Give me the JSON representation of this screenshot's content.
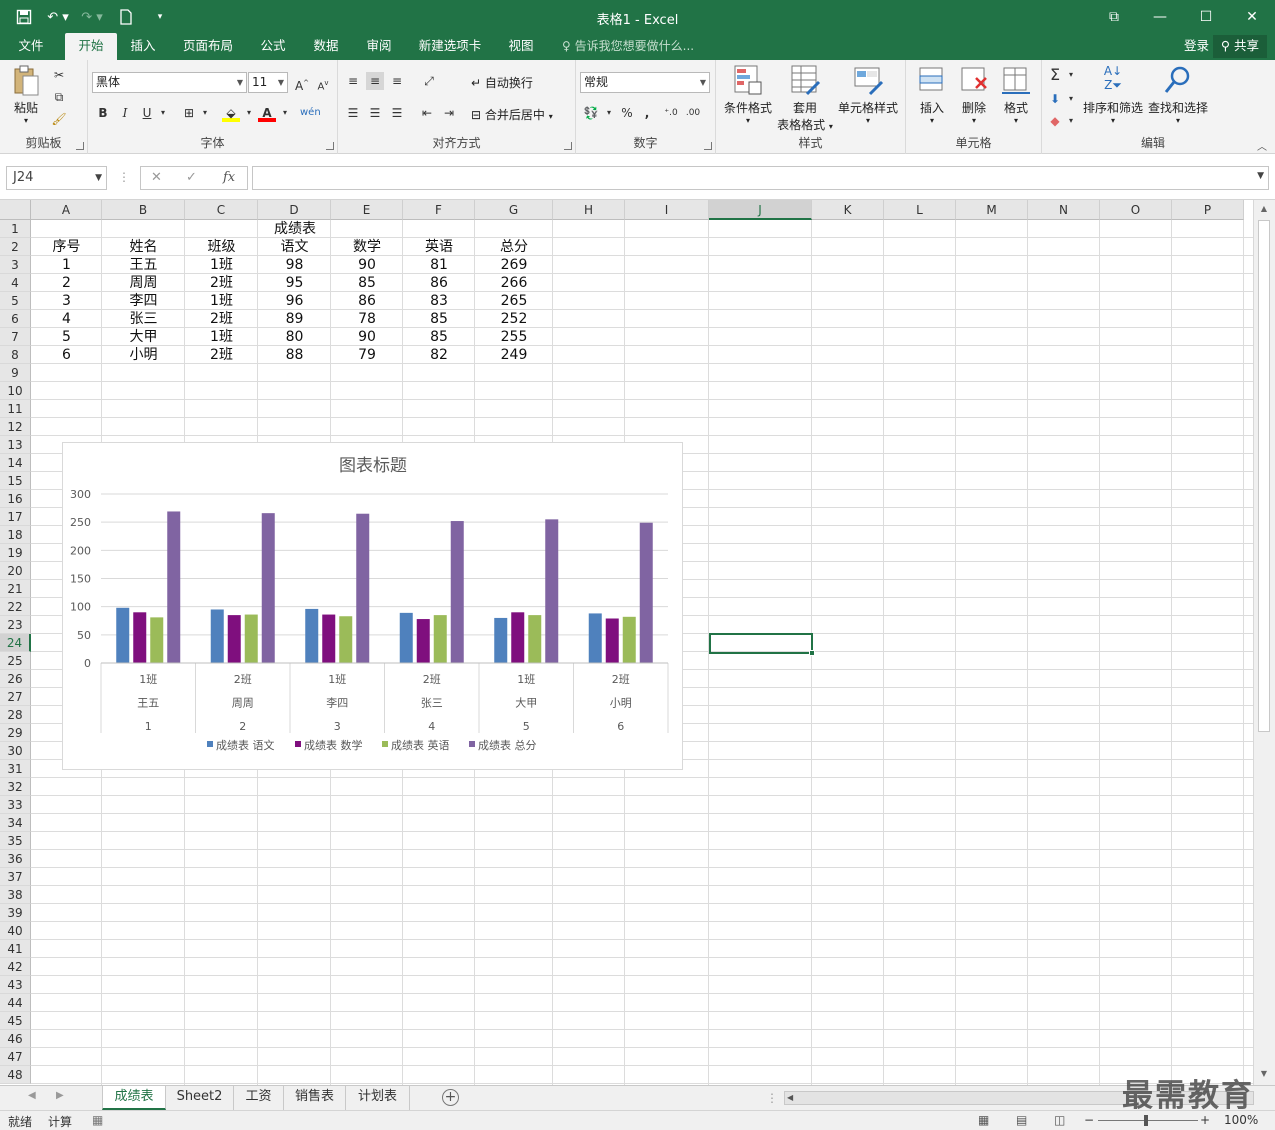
{
  "window": {
    "title": "表格1 - Excel",
    "qat": [
      "save-icon",
      "undo-icon",
      "redo-icon",
      "new-icon",
      "customize-icon"
    ],
    "controls": [
      "ribbon-display-icon",
      "minimize-icon",
      "maximize-icon",
      "close-icon"
    ]
  },
  "tabs": [
    {
      "label": "文件",
      "active": false
    },
    {
      "label": "开始",
      "active": true
    },
    {
      "label": "插入",
      "active": false
    },
    {
      "label": "页面布局",
      "active": false
    },
    {
      "label": "公式",
      "active": false
    },
    {
      "label": "数据",
      "active": false
    },
    {
      "label": "审阅",
      "active": false
    },
    {
      "label": "新建选项卡",
      "active": false
    },
    {
      "label": "视图",
      "active": false
    }
  ],
  "tell_me": "告诉我您想要做什么...",
  "login": "登录",
  "share": "共享",
  "ribbon": {
    "clipboard": {
      "label": "剪贴板",
      "paste": "粘贴"
    },
    "font": {
      "label": "字体",
      "family": "黑体",
      "size": "11",
      "bold": "B",
      "italic": "I",
      "underline": "U"
    },
    "alignment": {
      "label": "对齐方式",
      "wrap": "自动换行",
      "merge": "合并后居中"
    },
    "number": {
      "label": "数字",
      "format": "常规",
      "percent": "%",
      "comma": ","
    },
    "styles": {
      "label": "样式",
      "conditional": "条件格式",
      "table_1": "套用",
      "table_2": "表格格式",
      "cell_styles": "单元格样式"
    },
    "cells": {
      "label": "单元格",
      "insert": "插入",
      "delete": "删除",
      "format": "格式"
    },
    "editing": {
      "label": "编辑",
      "sort": "排序和筛选",
      "find": "查找和选择"
    }
  },
  "formula_bar": {
    "name_box": "J24",
    "value": ""
  },
  "columns": [
    "A",
    "B",
    "C",
    "D",
    "E",
    "F",
    "G",
    "H",
    "I",
    "J",
    "K",
    "L",
    "M",
    "N",
    "O",
    "P"
  ],
  "rows_count": 48,
  "selected_cell": {
    "col": "J",
    "row": 24
  },
  "table": {
    "title": "成绩表",
    "headers": [
      "序号",
      "姓名",
      "班级",
      "语文",
      "数学",
      "英语",
      "总分"
    ],
    "rows": [
      [
        "1",
        "王五",
        "1班",
        "98",
        "90",
        "81",
        "269"
      ],
      [
        "2",
        "周周",
        "2班",
        "95",
        "85",
        "86",
        "266"
      ],
      [
        "3",
        "李四",
        "1班",
        "96",
        "86",
        "83",
        "265"
      ],
      [
        "4",
        "张三",
        "2班",
        "89",
        "78",
        "85",
        "252"
      ],
      [
        "5",
        "大甲",
        "1班",
        "80",
        "90",
        "85",
        "255"
      ],
      [
        "6",
        "小明",
        "2班",
        "88",
        "79",
        "82",
        "249"
      ]
    ]
  },
  "chart_data": {
    "type": "bar",
    "title": "图表标题",
    "categories": [
      [
        "1班",
        "王五",
        "1"
      ],
      [
        "2班",
        "周周",
        "2"
      ],
      [
        "1班",
        "李四",
        "3"
      ],
      [
        "2班",
        "张三",
        "4"
      ],
      [
        "1班",
        "大甲",
        "5"
      ],
      [
        "2班",
        "小明",
        "6"
      ]
    ],
    "series": [
      {
        "name": "成绩表 语文",
        "color": "#4f81bd",
        "values": [
          98,
          95,
          96,
          89,
          80,
          88
        ]
      },
      {
        "name": "成绩表 数学",
        "color": "#7f0f7e",
        "values": [
          90,
          85,
          86,
          78,
          90,
          79
        ]
      },
      {
        "name": "成绩表 英语",
        "color": "#9bbb59",
        "values": [
          81,
          86,
          83,
          85,
          85,
          82
        ]
      },
      {
        "name": "成绩表 总分",
        "color": "#8064a2",
        "values": [
          269,
          266,
          265,
          252,
          255,
          249
        ]
      }
    ],
    "yticks": [
      "0",
      "50",
      "100",
      "150",
      "200",
      "250",
      "300"
    ],
    "ylim": [
      0,
      300
    ],
    "grid": true,
    "legend": "bottom"
  },
  "sheets": [
    {
      "label": "成绩表",
      "active": true
    },
    {
      "label": "Sheet2",
      "active": false
    },
    {
      "label": "工资",
      "active": false
    },
    {
      "label": "销售表",
      "active": false
    },
    {
      "label": "计划表",
      "active": false
    }
  ],
  "status": {
    "ready": "就绪",
    "calc": "计算",
    "zoom": "100%"
  },
  "watermark": "最需教育"
}
